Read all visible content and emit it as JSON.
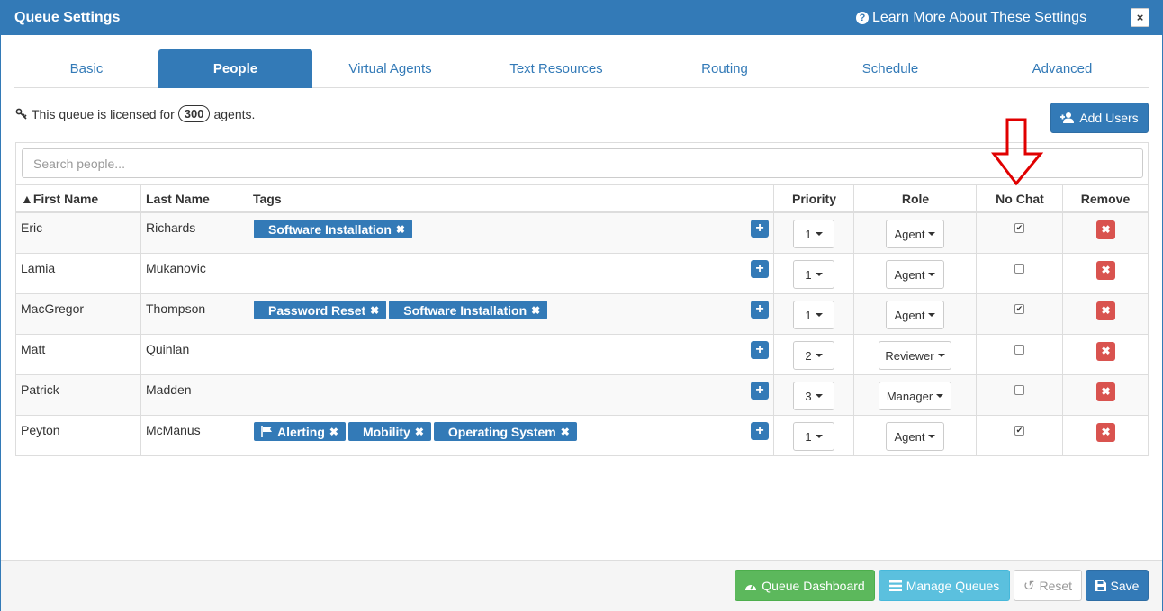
{
  "header": {
    "title": "Queue Settings",
    "learn_more": "Learn More About These Settings",
    "close": "×"
  },
  "tabs": [
    "Basic",
    "People",
    "Virtual Agents",
    "Text Resources",
    "Routing",
    "Schedule",
    "Advanced"
  ],
  "active_tab": "People",
  "license": {
    "prefix": "This queue is licensed for",
    "count": "300",
    "suffix": "agents."
  },
  "add_users": "Add Users",
  "search": {
    "placeholder": "Search people..."
  },
  "columns": {
    "first": "▲First Name",
    "last": "Last Name",
    "tags": "Tags",
    "priority": "Priority",
    "role": "Role",
    "nochat": "No Chat",
    "remove": "Remove"
  },
  "rows": [
    {
      "first": "Eric",
      "last": "Richards",
      "tags": [
        "Software Installation"
      ],
      "priority": "1",
      "role": "Agent",
      "nochat": true
    },
    {
      "first": "Lamia",
      "last": "Mukanovic",
      "tags": [],
      "priority": "1",
      "role": "Agent",
      "nochat": false
    },
    {
      "first": "MacGregor",
      "last": "Thompson",
      "tags": [
        "Password Reset",
        "Software Installation"
      ],
      "priority": "1",
      "role": "Agent",
      "nochat": true
    },
    {
      "first": "Matt",
      "last": "Quinlan",
      "tags": [],
      "priority": "2",
      "role": "Reviewer",
      "nochat": false
    },
    {
      "first": "Patrick",
      "last": "Madden",
      "tags": [],
      "priority": "3",
      "role": "Manager",
      "nochat": false
    },
    {
      "first": "Peyton",
      "last": "McManus",
      "tags": [
        "Alerting",
        "Mobility",
        "Operating System"
      ],
      "priority": "1",
      "role": "Agent",
      "nochat": true
    }
  ],
  "footer": {
    "dashboard": "Queue Dashboard",
    "manage": "Manage Queues",
    "reset": "Reset",
    "save": "Save"
  },
  "colors": {
    "primary": "#337ab7",
    "success": "#5cb85c",
    "info": "#5bc0de",
    "danger": "#d9534f",
    "arrow": "#e00000"
  }
}
